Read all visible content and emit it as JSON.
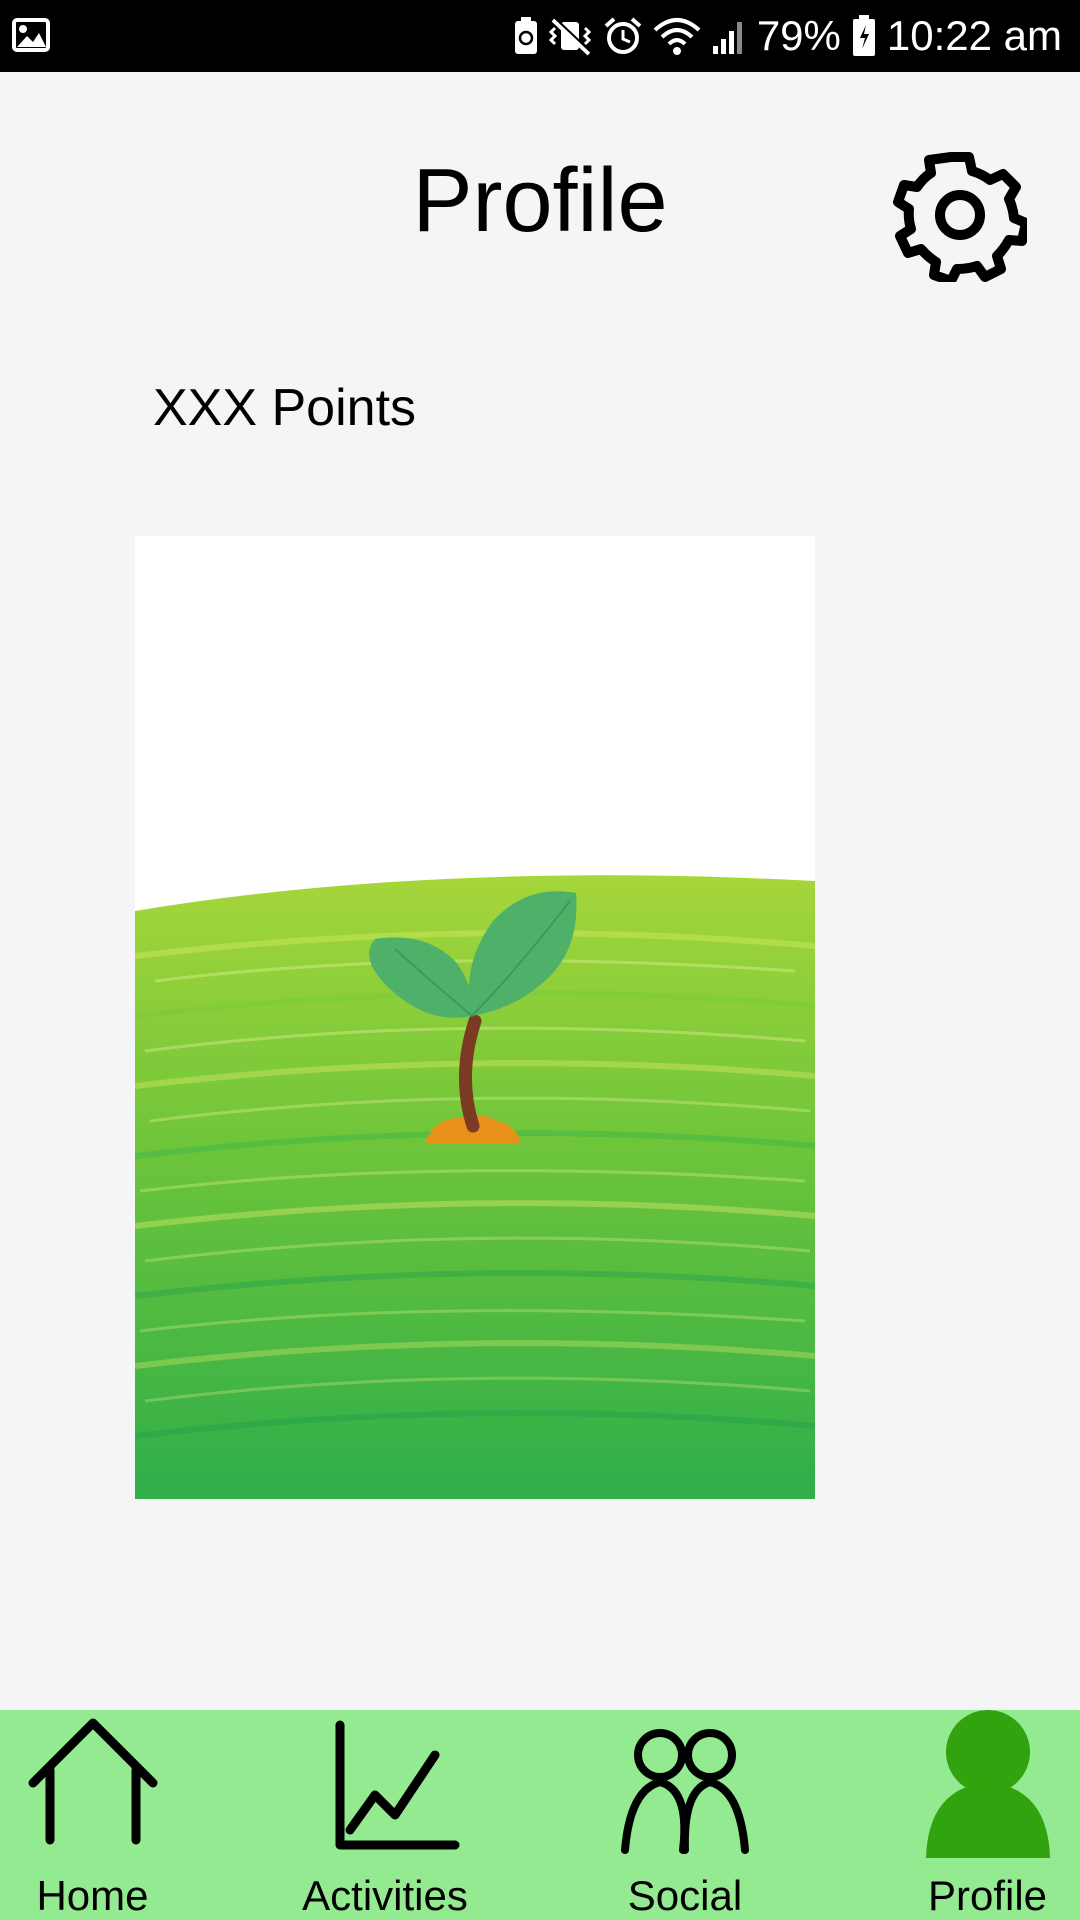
{
  "status_bar": {
    "battery_percent": "79%",
    "time": "10:22 am",
    "icons": [
      "gallery-icon",
      "battery-saver-icon",
      "vibrate-mute-icon",
      "alarm-icon",
      "wifi-icon",
      "signal-icon",
      "battery-icon"
    ]
  },
  "header": {
    "title": "Profile",
    "settings_icon": "gear-icon"
  },
  "points": {
    "label": "XXX Points"
  },
  "plant": {
    "icon": "sprout-on-hill-illustration",
    "colors": {
      "leaf": "#4fb06a",
      "stem": "#7a3b22",
      "soil": "#e8901a",
      "grass_light": "#a6d63a",
      "grass_dark": "#2fae4a"
    }
  },
  "bottom_nav": {
    "background": "#93ea90",
    "active_color": "#31a30e",
    "items": [
      {
        "label": "Home",
        "icon": "home-icon",
        "active": false
      },
      {
        "label": "Activities",
        "icon": "line-chart-icon",
        "active": false
      },
      {
        "label": "Social",
        "icon": "people-icon",
        "active": false
      },
      {
        "label": "Profile",
        "icon": "person-icon",
        "active": true
      }
    ]
  }
}
